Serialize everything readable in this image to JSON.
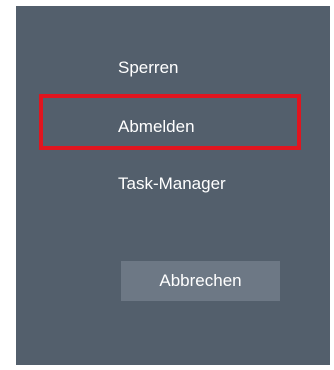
{
  "menu": {
    "items": [
      {
        "label": "Sperren"
      },
      {
        "label": "Abmelden"
      },
      {
        "label": "Task-Manager"
      }
    ],
    "highlighted_item": "Abmelden",
    "highlight_color": "#e0151f"
  },
  "actions": {
    "cancel_label": "Abbrechen"
  },
  "colors": {
    "panel_background": "#535f6c",
    "button_background": "#6d7885",
    "text": "#ffffff"
  }
}
